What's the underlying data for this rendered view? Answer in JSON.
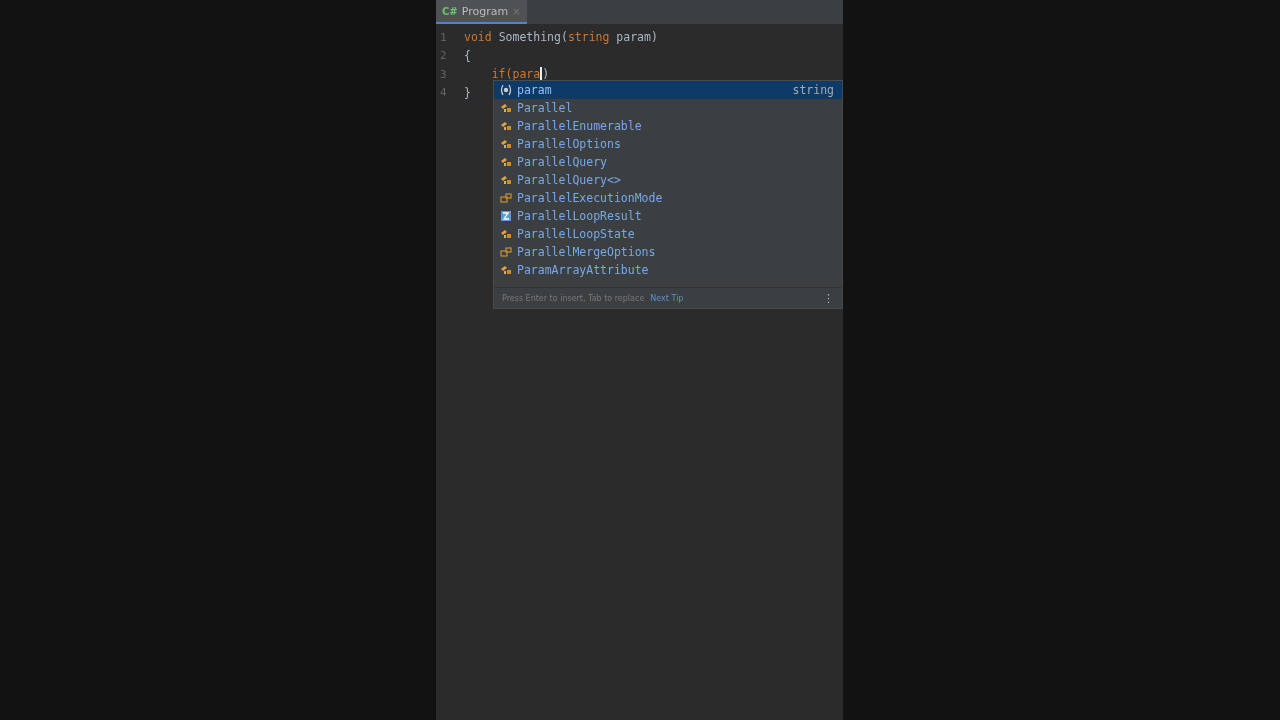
{
  "tab": {
    "badge": "C#",
    "title": "Program",
    "close": "×",
    "selected": true
  },
  "editor": {
    "lines": [
      {
        "number": "1",
        "tokens": [
          {
            "kind": "keyword",
            "text": "void"
          },
          {
            "kind": "plain",
            "text": " Something("
          },
          {
            "kind": "keyword",
            "text": "string"
          },
          {
            "kind": "plain",
            "text": " param)"
          }
        ]
      },
      {
        "number": "2",
        "tokens": [
          {
            "kind": "plain",
            "text": "{"
          }
        ]
      },
      {
        "number": "3",
        "tokens": [
          {
            "kind": "keyword",
            "text": "    if(para"
          },
          {
            "kind": "caret"
          },
          {
            "kind": "plain",
            "text": ")"
          }
        ]
      },
      {
        "number": "4",
        "tokens": [
          {
            "kind": "plain",
            "text": "}"
          }
        ]
      }
    ]
  },
  "completion": {
    "items": [
      {
        "kind": "parameter",
        "name": "param",
        "type": "string",
        "selected": true
      },
      {
        "kind": "class",
        "name": "Parallel",
        "selected": false
      },
      {
        "kind": "class",
        "name": "ParallelEnumerable",
        "selected": false
      },
      {
        "kind": "class",
        "name": "ParallelOptions",
        "selected": false
      },
      {
        "kind": "class",
        "name": "ParallelQuery",
        "selected": false
      },
      {
        "kind": "class",
        "name": "ParallelQuery<>",
        "selected": false
      },
      {
        "kind": "enum",
        "name": "ParallelExecutionMode",
        "selected": false
      },
      {
        "kind": "struct",
        "name": "ParallelLoopResult",
        "selected": false
      },
      {
        "kind": "class",
        "name": "ParallelLoopState",
        "selected": false
      },
      {
        "kind": "enum",
        "name": "ParallelMergeOptions",
        "selected": false
      },
      {
        "kind": "class",
        "name": "ParamArrayAttribute",
        "selected": false
      }
    ],
    "hint": "Press Enter to insert, Tab to replace",
    "tip_link": "Next Tip",
    "more": "⋮"
  }
}
